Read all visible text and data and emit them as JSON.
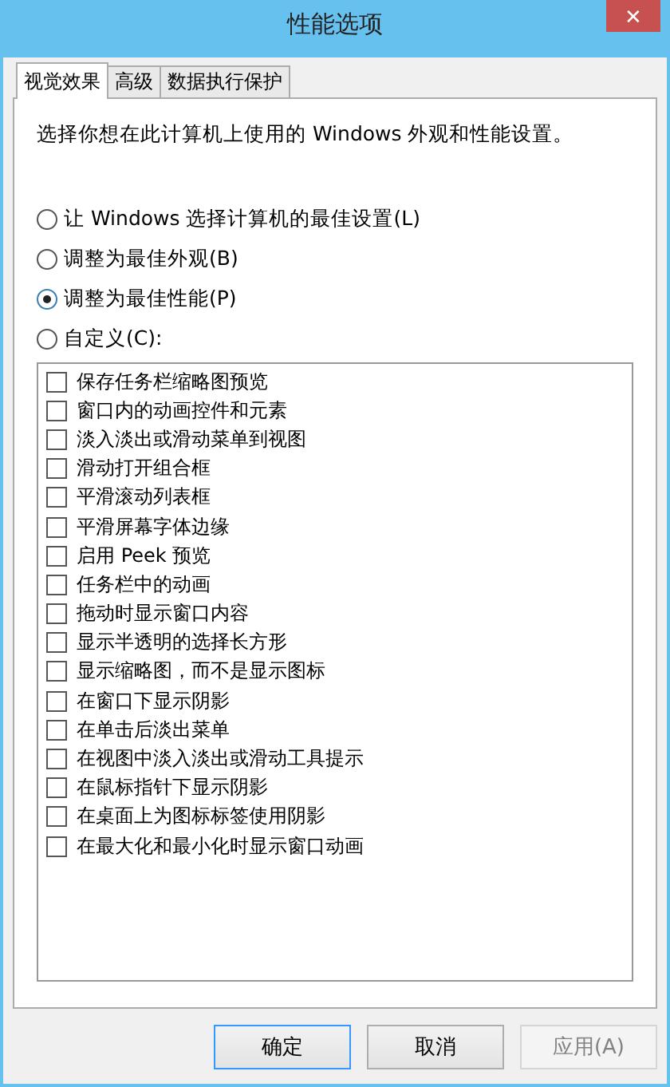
{
  "window": {
    "title": "性能选项",
    "close": "✕"
  },
  "tabs": [
    {
      "label": "视觉效果",
      "selected": true
    },
    {
      "label": "高级",
      "selected": false
    },
    {
      "label": "数据执行保护",
      "selected": false
    }
  ],
  "intro": "选择你想在此计算机上使用的 Windows 外观和性能设置。",
  "options": [
    {
      "label": "让 Windows 选择计算机的最佳设置(L)",
      "selected": false
    },
    {
      "label": "调整为最佳外观(B)",
      "selected": false
    },
    {
      "label": "调整为最佳性能(P)",
      "selected": true
    },
    {
      "label": "自定义(C):",
      "selected": false
    }
  ],
  "effects": [
    {
      "label": "保存任务栏缩略图预览",
      "checked": false
    },
    {
      "label": "窗口内的动画控件和元素",
      "checked": false
    },
    {
      "label": "淡入淡出或滑动菜单到视图",
      "checked": false
    },
    {
      "label": "滑动打开组合框",
      "checked": false
    },
    {
      "label": "平滑滚动列表框",
      "checked": false
    },
    {
      "label": "平滑屏幕字体边缘",
      "checked": false
    },
    {
      "label": "启用 Peek 预览",
      "checked": false
    },
    {
      "label": "任务栏中的动画",
      "checked": false
    },
    {
      "label": "拖动时显示窗口内容",
      "checked": false
    },
    {
      "label": "显示半透明的选择长方形",
      "checked": false
    },
    {
      "label": "显示缩略图，而不是显示图标",
      "checked": false
    },
    {
      "label": "在窗口下显示阴影",
      "checked": false
    },
    {
      "label": "在单击后淡出菜单",
      "checked": false
    },
    {
      "label": "在视图中淡入淡出或滑动工具提示",
      "checked": false
    },
    {
      "label": "在鼠标指针下显示阴影",
      "checked": false
    },
    {
      "label": "在桌面上为图标标签使用阴影",
      "checked": false
    },
    {
      "label": "在最大化和最小化时显示窗口动画",
      "checked": false
    }
  ],
  "buttons": [
    {
      "label": "确定",
      "disabled": false,
      "default": true
    },
    {
      "label": "取消",
      "disabled": false,
      "default": false
    },
    {
      "label": "应用(A)",
      "disabled": true,
      "default": false
    }
  ]
}
